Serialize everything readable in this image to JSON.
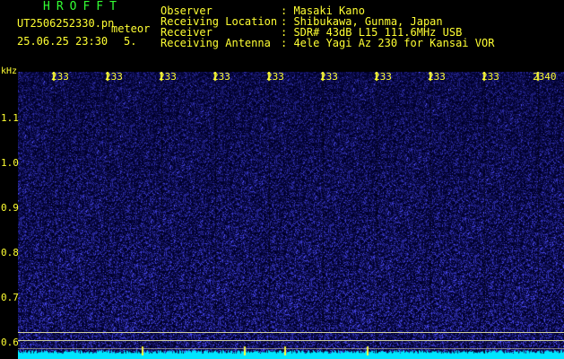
{
  "app_title": "HROFFT",
  "file_name": "UT2506252330.pn",
  "file_type": "meteor",
  "date": "25.06.25 23:30",
  "counter": "5.",
  "info": [
    {
      "label": "Observer",
      "value": ": Masaki Kano"
    },
    {
      "label": "Receiving Location",
      "value": ": Shibukawa, Gunma, Japan"
    },
    {
      "label": "Receiver",
      "value": ": SDR# 43dB L15 111.6MHz USB"
    },
    {
      "label": "Receiving Antenna",
      "value": ": 4ele Yagi Az 230 for Kansai VOR"
    }
  ],
  "x_ticks": [
    "233",
    "233",
    "233",
    "233",
    "233",
    "233",
    "233",
    "233",
    "233",
    "2340"
  ],
  "y_unit": "kHz",
  "y_ticks": [
    "1.1",
    "1.0",
    "0.9",
    "0.8",
    "0.7",
    "0.6"
  ],
  "colors": {
    "text": "#ffff33",
    "title": "#33ff33",
    "signal": "#2a2aff",
    "baseline": "#00e5ff"
  }
}
